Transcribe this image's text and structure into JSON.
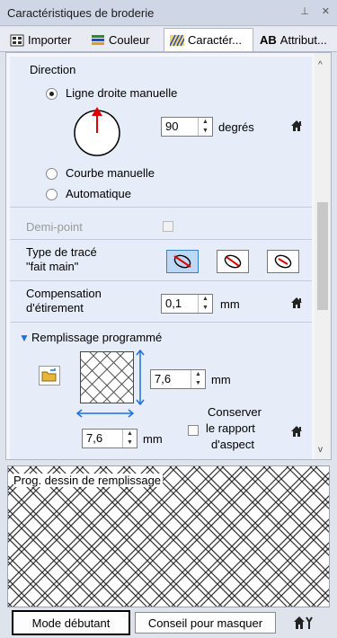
{
  "window": {
    "title": "Caractéristiques de broderie",
    "pin_icon": "pin-icon",
    "close_icon": "close-icon"
  },
  "tabs": [
    {
      "label": "Importer",
      "icon": "import-icon"
    },
    {
      "label": "Couleur",
      "icon": "color-icon"
    },
    {
      "label": "Caractér...",
      "icon": "character-icon",
      "active": true
    },
    {
      "label": "Attribut...",
      "icon": "attribute-icon"
    }
  ],
  "direction": {
    "heading": "Direction",
    "option_manual_line": "Ligne droite manuelle",
    "angle_value": "90",
    "angle_unit": "degrés",
    "option_manual_curve": "Courbe manuelle",
    "option_auto": "Automatique",
    "selected": "Ligne droite manuelle"
  },
  "half_stitch": {
    "label": "Demi-point",
    "checked": false,
    "enabled": false
  },
  "trace_type": {
    "label_line1": "Type de tracé",
    "label_line2": "\"fait main\"",
    "selected_index": 0
  },
  "compensation": {
    "label_line1": "Compensation",
    "label_line2": "d'étirement",
    "value": "0,1",
    "unit": "mm"
  },
  "programmed_fill": {
    "heading": "Remplissage programmé",
    "height_value": "7,6",
    "height_unit": "mm",
    "width_value": "7,6",
    "width_unit": "mm",
    "keep_aspect_line1": "Conserver",
    "keep_aspect_line2": "le rapport",
    "keep_aspect_line3": "d'aspect",
    "keep_aspect_checked": false
  },
  "preview": {
    "label": "Prog. dessin de remplissage"
  },
  "bottom": {
    "beginner_mode": "Mode débutant",
    "hide_tips": "Conseil pour masquer"
  },
  "colors": {
    "accent": "#1e6fd9",
    "arrow_red": "#e00000",
    "panel_bg": "#f4f6fb"
  }
}
